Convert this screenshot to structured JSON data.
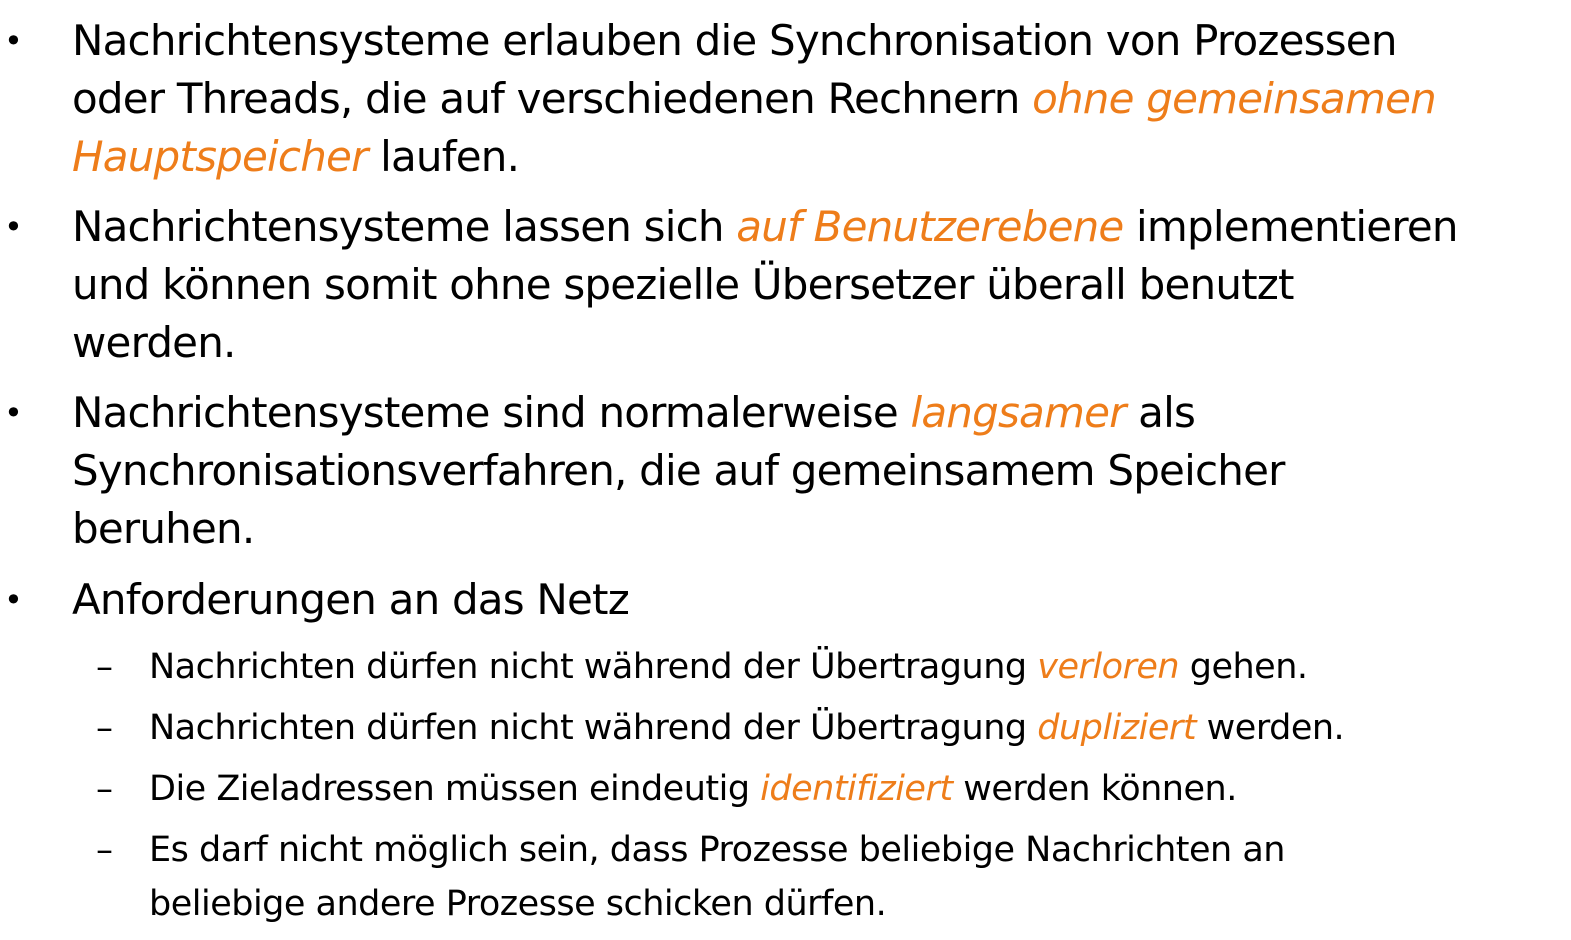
{
  "colors": {
    "text": "#000000",
    "highlight": "#ee7d1a",
    "background": "#ffffff"
  },
  "bullets": [
    {
      "marker": "•",
      "lines": [
        [
          {
            "t": "Nachrichtensysteme erlauben die Synchronisation von Prozessen",
            "hl": false
          }
        ],
        [
          {
            "t": "oder Threads, die auf verschiedenen Rechnern ",
            "hl": false
          },
          {
            "t": "ohne gemeinsamen",
            "hl": true
          }
        ],
        [
          {
            "t": "Hauptspeicher",
            "hl": true
          },
          {
            "t": " laufen.",
            "hl": false
          }
        ]
      ]
    },
    {
      "marker": "•",
      "lines": [
        [
          {
            "t": "Nachrichtensysteme lassen sich ",
            "hl": false
          },
          {
            "t": "auf Benutzerebene",
            "hl": true
          },
          {
            "t": " implementieren",
            "hl": false
          }
        ],
        [
          {
            "t": "und können somit ohne spezielle Übersetzer überall benutzt",
            "hl": false
          }
        ],
        [
          {
            "t": "werden.",
            "hl": false
          }
        ]
      ]
    },
    {
      "marker": "•",
      "lines": [
        [
          {
            "t": "Nachrichtensysteme sind normalerweise ",
            "hl": false
          },
          {
            "t": "langsamer",
            "hl": true
          },
          {
            "t": " als",
            "hl": false
          }
        ],
        [
          {
            "t": "Synchronisationsverfahren, die auf gemeinsamem Speicher",
            "hl": false
          }
        ],
        [
          {
            "t": "beruhen.",
            "hl": false
          }
        ]
      ]
    },
    {
      "marker": "•",
      "lines": [
        [
          {
            "t": "Anforderungen an das Netz",
            "hl": false
          }
        ]
      ]
    }
  ],
  "sub_bullets": [
    {
      "marker": "–",
      "lines": [
        [
          {
            "t": "Nachrichten dürfen nicht während der Übertragung ",
            "hl": false
          },
          {
            "t": "verloren",
            "hl": true
          },
          {
            "t": " gehen.",
            "hl": false
          }
        ]
      ]
    },
    {
      "marker": "–",
      "lines": [
        [
          {
            "t": "Nachrichten dürfen nicht während der Übertragung ",
            "hl": false
          },
          {
            "t": "dupliziert",
            "hl": true
          },
          {
            "t": " werden.",
            "hl": false
          }
        ]
      ]
    },
    {
      "marker": "–",
      "lines": [
        [
          {
            "t": "Die Zieladressen müssen eindeutig ",
            "hl": false
          },
          {
            "t": "identifiziert",
            "hl": true
          },
          {
            "t": " werden können.",
            "hl": false
          }
        ]
      ]
    },
    {
      "marker": "–",
      "lines": [
        [
          {
            "t": "Es darf nicht möglich sein, dass Prozesse beliebige Nachrichten an",
            "hl": false
          }
        ],
        [
          {
            "t": "beliebige andere Prozesse schicken dürfen.",
            "hl": false
          }
        ]
      ]
    }
  ]
}
